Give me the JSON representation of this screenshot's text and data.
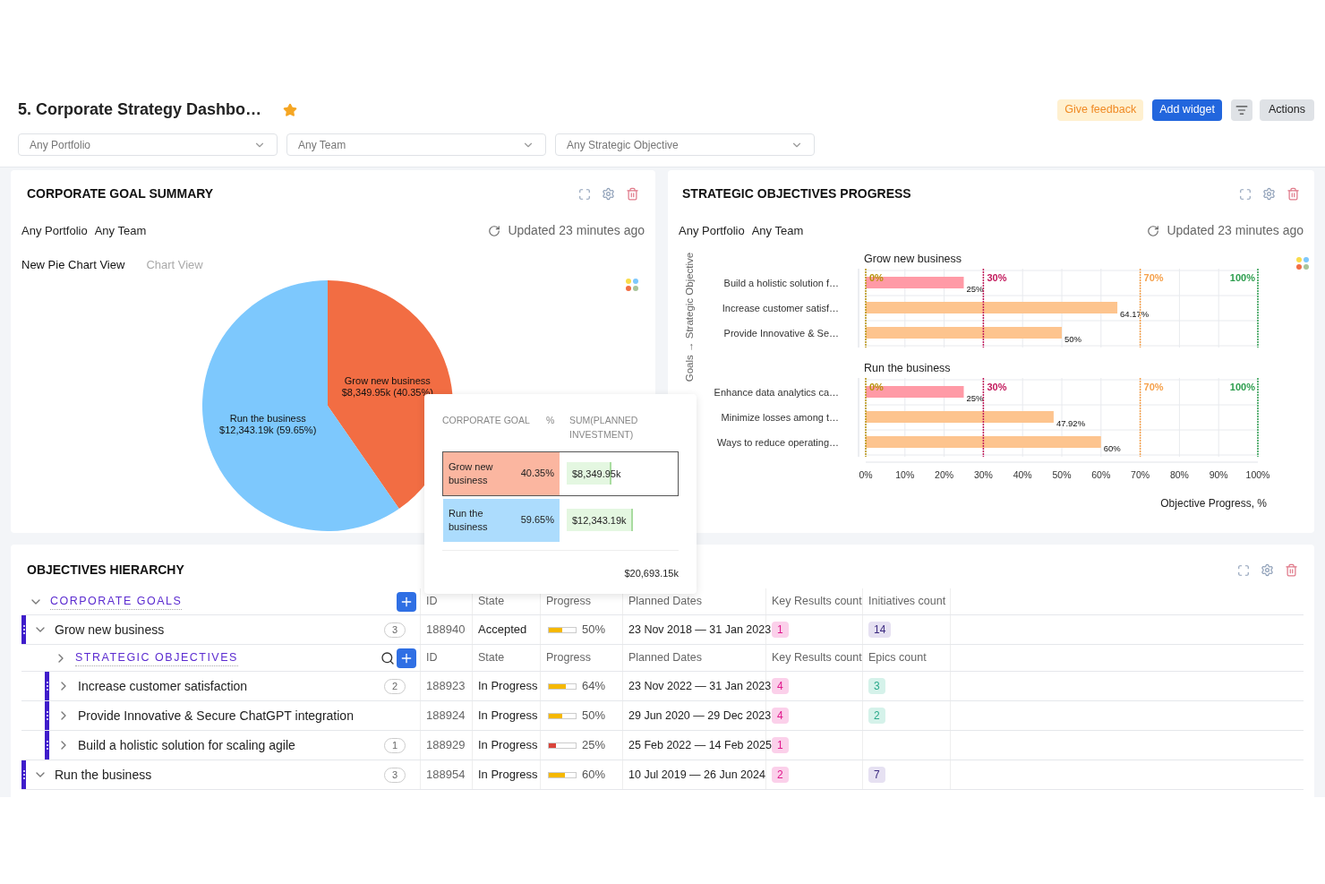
{
  "header": {
    "title": "5. Corporate Strategy Dashbo…",
    "starred": true,
    "feedback_button": "Give feedback",
    "add_button": "Add widget",
    "actions_button": "Actions"
  },
  "filters": [
    {
      "value": "Any Portfolio"
    },
    {
      "value": "Any Team"
    },
    {
      "value": "Any Strategic Objective"
    }
  ],
  "goal_summary": {
    "title": "CORPORATE GOAL SUMMARY",
    "filters": [
      "Any Portfolio",
      "Any Team"
    ],
    "updated": "Updated 23 minutes ago",
    "views": [
      {
        "label": "New Pie Chart View",
        "selected": true
      },
      {
        "label": "Chart View",
        "selected": false
      }
    ],
    "chart_data": {
      "type": "pie",
      "categories": [
        "Grow new business",
        "Run the business"
      ],
      "values": [
        40.35,
        59.65
      ]
    },
    "slices": [
      {
        "label": "$8,349.95k (40.35%)",
        "color": "#f26d43"
      },
      {
        "label": "$12,343.19k (59.65%)",
        "color": "#7dc8fd"
      }
    ],
    "legend_table": {
      "columns": [
        "CORPORATE GOAL",
        "%",
        "SUM(PLANNED\nINVESTMENT)"
      ],
      "rows": [
        {
          "goal": "Grow new business",
          "percent": "40.35%",
          "sum": "$8,349.95k",
          "selected": true,
          "color": "#fbb6a0"
        },
        {
          "goal": "Run the business",
          "percent": "59.65%",
          "sum": "$12,343.19k",
          "selected": false,
          "color": "#acdcfd"
        }
      ],
      "total": "$20,693.15k"
    }
  },
  "objectives_progress": {
    "title": "STRATEGIC OBJECTIVES PROGRESS",
    "filters": [
      "Any Portfolio",
      "Any Team"
    ],
    "updated": "Updated 23 minutes ago",
    "chart_data": {
      "type": "bar",
      "orientation": "horizontal",
      "grid": true,
      "xlabel": "Objective Progress, %",
      "ylabel": "Goals → Strategic Objective",
      "categories": [
        "Build a holistic solution f…",
        "Increase customer satisf…",
        "Provide Innovative & Se…",
        "Enhance data analytics ca…",
        "Minimize losses among t…",
        "Ways to reduce operating…"
      ],
      "values": [
        25,
        64.17,
        50,
        25,
        47.92,
        60
      ],
      "value_labels": [
        "25%",
        "64.17%",
        "50%",
        "25%",
        "47.92%",
        "60%"
      ],
      "xlim": [
        0,
        100
      ],
      "xticks": [
        {
          "value": 0,
          "label": "0%"
        },
        {
          "value": 10,
          "label": "10%"
        },
        {
          "value": 20,
          "label": "20%"
        },
        {
          "value": 30,
          "label": "30%"
        },
        {
          "value": 40,
          "label": "40%"
        },
        {
          "value": 50,
          "label": "50%"
        },
        {
          "value": 60,
          "label": "60%"
        },
        {
          "value": 70,
          "label": "70%"
        },
        {
          "value": 80,
          "label": "80%"
        },
        {
          "value": 90,
          "label": "90%"
        },
        {
          "value": 100,
          "label": "100%"
        }
      ]
    },
    "groups": [
      {
        "title": "Grow new business",
        "thresholds": [
          {
            "label": "0%",
            "color": "#b8920a"
          },
          {
            "label": "30%",
            "color": "#c2185b"
          },
          {
            "label": "70%",
            "color": "#f5a04a"
          },
          {
            "label": "100%",
            "color": "#2e9e4f"
          }
        ]
      },
      {
        "title": "Run the business",
        "thresholds": [
          {
            "label": "0%",
            "color": "#b8920a"
          },
          {
            "label": "30%",
            "color": "#c2185b"
          },
          {
            "label": "70%",
            "color": "#f5a04a"
          },
          {
            "label": "100%",
            "color": "#2e9e4f"
          }
        ]
      }
    ]
  },
  "hierarchy": {
    "title": "OBJECTIVES HIERARCHY",
    "header": {
      "label": "CORPORATE GOALS",
      "expanded": true,
      "columns": [
        "ID",
        "State",
        "Progress",
        "Planned Dates",
        "Key Results count",
        "Initiatives count"
      ]
    },
    "goals": [
      {
        "name": "Grow new business",
        "expanded": true,
        "count": "3",
        "id": "188940",
        "state": "Accepted",
        "level": 0.5,
        "color": "#f5b800",
        "progress": "50%",
        "dates": "23 Nov 2018 — 31 Jan 2023",
        "key_results": "1",
        "initiatives": "14",
        "children_header": {
          "label": "STRATEGIC OBJECTIVES",
          "expanded": false,
          "columns": [
            "ID",
            "State",
            "Progress",
            "Planned Dates",
            "Key Results count",
            "Epics count"
          ]
        },
        "children": [
          {
            "name": "Increase customer satisfaction",
            "expanded": false,
            "count": "2",
            "id": "188923",
            "state": "In Progress",
            "level": 0.64,
            "color": "#f5b800",
            "progress": "64%",
            "dates": "23 Nov 2022 — 31 Jan 2023",
            "key_results": "4",
            "epics": "3"
          },
          {
            "name": "Provide Innovative & Secure ChatGPT integration",
            "expanded": false,
            "id": "188924",
            "state": "In Progress",
            "level": 0.5,
            "color": "#f5b800",
            "progress": "50%",
            "dates": "29 Jun 2020 — 29 Dec 2023",
            "key_results": "4",
            "epics": "2"
          },
          {
            "name": "Build a holistic solution for scaling agile",
            "expanded": false,
            "count": "1",
            "id": "188929",
            "state": "In Progress",
            "level": 0.25,
            "color": "#d9443b",
            "progress": "25%",
            "dates": "25 Feb 2022 — 14 Feb 2025",
            "key_results": "1"
          }
        ]
      },
      {
        "name": "Run the business",
        "expanded": true,
        "count": "3",
        "id": "188954",
        "state": "In Progress",
        "level": 0.6,
        "color": "#f5b800",
        "progress": "60%",
        "dates": "10 Jul 2019 — 26 Jun 2024",
        "key_results": "2",
        "initiatives": "7"
      }
    ]
  }
}
